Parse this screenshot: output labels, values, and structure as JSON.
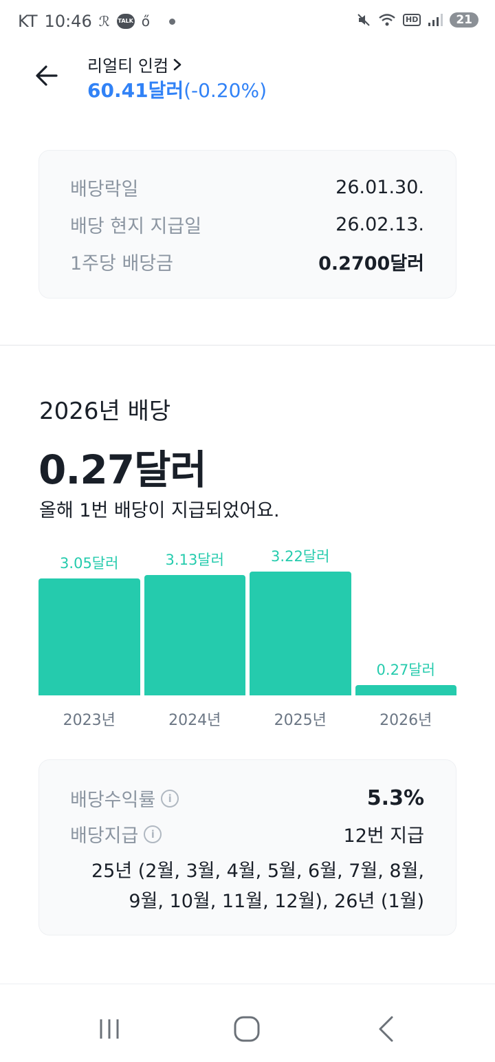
{
  "status_bar": {
    "carrier": "KT",
    "time": "10:46",
    "talk_badge": "TALK",
    "hd": "HD",
    "battery": "21"
  },
  "header": {
    "stock_name": "리얼티 인컴",
    "price": "60.41달러",
    "change": "(-0.20%)"
  },
  "dividend_info": {
    "rows": [
      {
        "label": "배당락일",
        "value": "26.01.30."
      },
      {
        "label": "배당 현지 지급일",
        "value": "26.02.13."
      },
      {
        "label": "1주당 배당금",
        "value": "0.2700달러"
      }
    ]
  },
  "section": {
    "title": "2026년 배당",
    "amount": "0.27달러",
    "description": "올해 1번 배당이 지급되었어요."
  },
  "chart_data": {
    "type": "bar",
    "categories": [
      "2023년",
      "2024년",
      "2025년",
      "2026년"
    ],
    "values": [
      3.05,
      3.13,
      3.22,
      0.27
    ],
    "data_labels": [
      "3.05달러",
      "3.13달러",
      "3.22달러",
      "0.27달러"
    ],
    "unit": "달러",
    "colors": {
      "bar": "#25cbad",
      "label": "#25cbad",
      "axis_text": "#6b7684"
    },
    "ylim": [
      0,
      3.22
    ]
  },
  "yield_info": {
    "yield_label": "배당수익률",
    "yield_value": "5.3%",
    "payment_label": "배당지급",
    "payment_value": "12번 지급",
    "months_line1": "25년 (2월, 3월, 4월, 5월, 6월, 7월, 8월,",
    "months_line2": "9월, 10월, 11월, 12월), 26년 (1월)"
  },
  "nav": {
    "icons": [
      "recent-apps-icon",
      "home-icon",
      "back-icon"
    ]
  },
  "colors": {
    "accent": "#3182f6",
    "bar": "#25cbad",
    "text_primary": "#191f28",
    "text_secondary": "#8b95a1"
  }
}
